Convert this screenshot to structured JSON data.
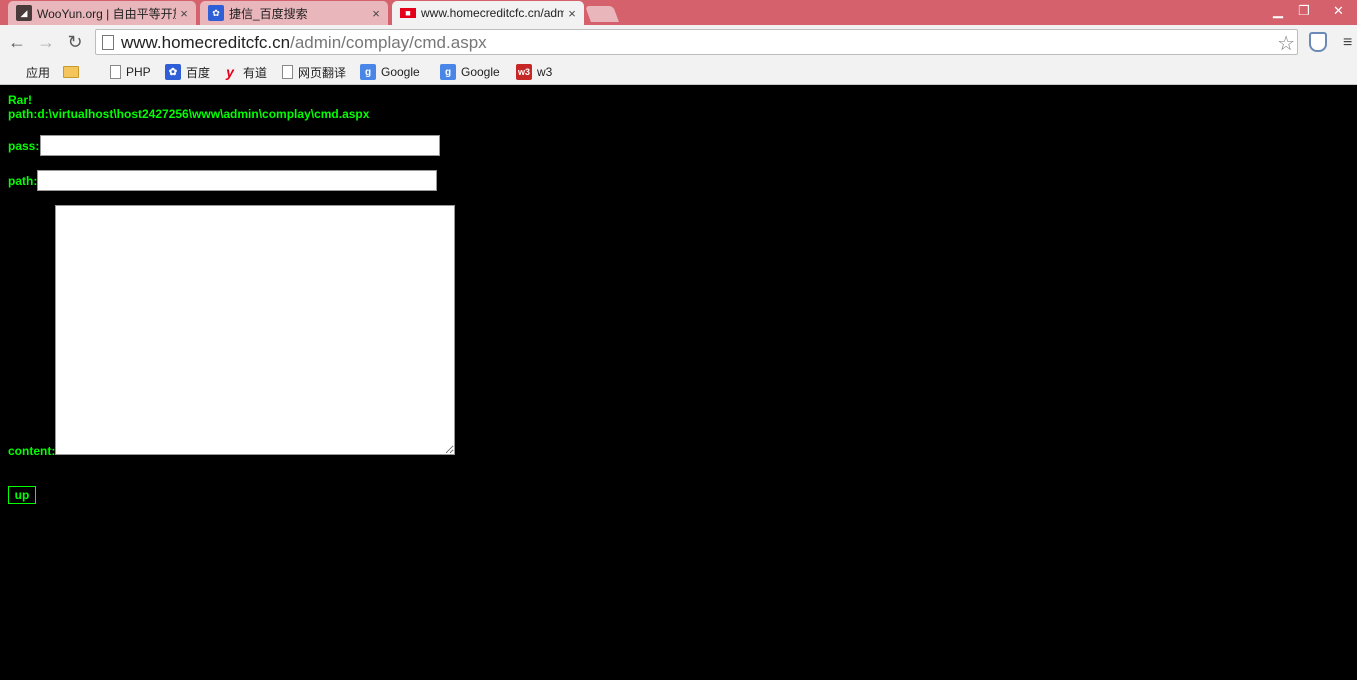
{
  "tabs": [
    {
      "title": "WooYun.org | 自由平等开放的漏洞报告平台",
      "active": false,
      "favicon": "wooyun-icon"
    },
    {
      "title": "捷信_百度搜索",
      "active": false,
      "favicon": "baidu-paw-icon"
    },
    {
      "title": "www.homecreditcfc.cn/admin/complay/cmd.aspx",
      "active": true,
      "favicon": "site-logo-icon"
    }
  ],
  "tab_close": "×",
  "address_bar": {
    "host": "www.homecreditcfc.cn",
    "path": "/admin/complay/cmd.aspx"
  },
  "bookmarks": [
    {
      "label": "应用",
      "icon": "apps-grid-icon"
    },
    {
      "label": "",
      "icon": "folder-icon"
    },
    {
      "label": "PHP",
      "icon": "page-icon"
    },
    {
      "label": "百度",
      "icon": "baidu-paw-icon"
    },
    {
      "label": "有道",
      "icon": "youdao-icon"
    },
    {
      "label": "网页翻译",
      "icon": "page-icon"
    },
    {
      "label": "Google",
      "icon": "google-icon"
    },
    {
      "label": "Google",
      "icon": "google-icon"
    },
    {
      "label": "w3",
      "icon": "w3-icon"
    }
  ],
  "page": {
    "heading": "Rar!",
    "path_line": "path:d:\\virtualhost\\host2427256\\www\\admin\\complay\\cmd.aspx",
    "pass_label": "pass:",
    "pass_value": "",
    "path_label": "path:",
    "path_value": "",
    "content_label": "content:",
    "content_value": "",
    "submit_label": "up"
  },
  "colors": {
    "tabstrip": "#d4616c",
    "page_background": "#000000",
    "page_text": "#00ff00"
  }
}
